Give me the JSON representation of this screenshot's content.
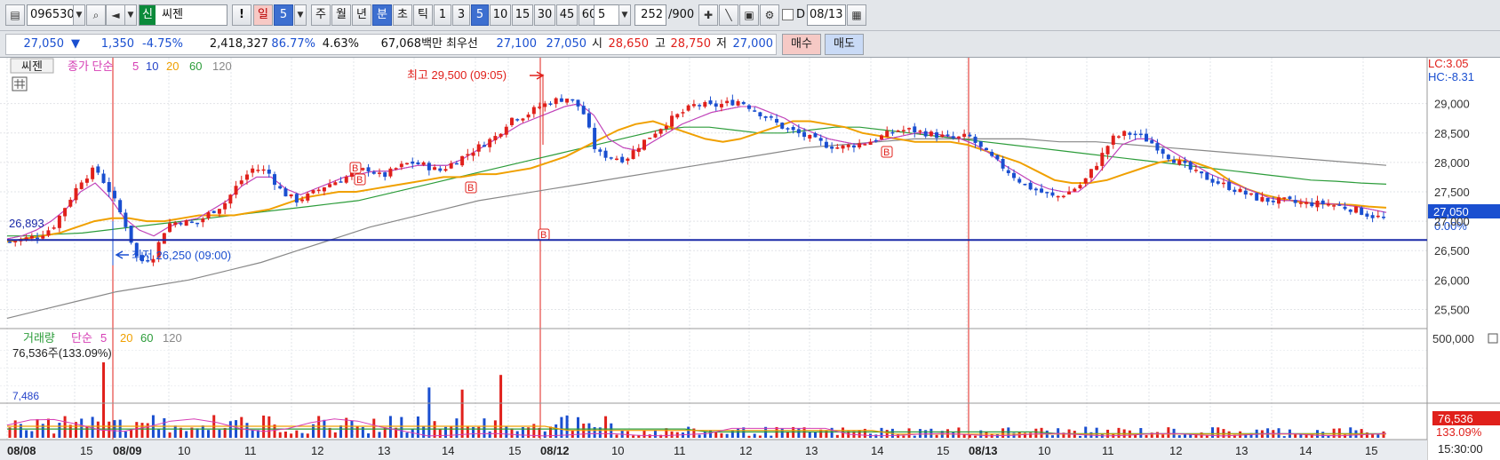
{
  "toolbar": {
    "code": "096530",
    "market_badge": "신",
    "name": "씨젠",
    "alert": "!",
    "period_day": "일",
    "period_day_num": "5",
    "period_week": "주",
    "period_month": "월",
    "period_year": "년",
    "period_min": "분",
    "period_sec": "초",
    "period_tick": "틱",
    "intervals": [
      "1",
      "3",
      "5",
      "10",
      "15",
      "30",
      "45",
      "60"
    ],
    "active_interval": "5",
    "interval_select": "5",
    "count": "252",
    "count_total": "/900",
    "d_label": "D",
    "date": "08/13"
  },
  "quote": {
    "price": "27,050",
    "arrow": "▼",
    "change": "1,350",
    "change_pct": "-4.75%",
    "volume": "2,418,327",
    "ratio": "86.77%",
    "turnover_pct": "4.63%",
    "amount": "67,068백만",
    "best_label": "최우선",
    "best_ask": "27,100",
    "best_bid": "27,050",
    "open_label": "시",
    "open": "28,650",
    "high_label": "고",
    "high": "28,750",
    "low_label": "저",
    "low": "27,000",
    "buy": "매수",
    "sell": "매도"
  },
  "legend": {
    "stock": "씨젠",
    "indicator": "종가 단순",
    "ma": [
      "5",
      "10",
      "20",
      "60",
      "120"
    ],
    "vol_title": "거래량",
    "vol_indicator": "단순",
    "vol_value": "76,536주(133.09%)"
  },
  "annotations": {
    "max": "최고 29,500 (09:05)",
    "min": "최저 26,250 (09:00)",
    "hline_value": "26,893",
    "vol_left": "7,486",
    "buy_marker": "B"
  },
  "right_axis": {
    "lc": "LC:3.05",
    "hc": "HC:-8.31",
    "price_ticks": [
      "29,000",
      "28,500",
      "28,000",
      "27,500",
      "27,000",
      "26,500",
      "26,000",
      "25,500"
    ],
    "current": "27,050",
    "pct": "0.00%",
    "vol_tick": "500,000",
    "vol_current": "76,536",
    "vol_pct": "133.09%",
    "time": "15:30:00"
  },
  "x_axis": [
    "08/08",
    "15",
    "08/09",
    "10",
    "11",
    "12",
    "13",
    "14",
    "15",
    "08/12",
    "10",
    "11",
    "12",
    "13",
    "14",
    "15",
    "08/13",
    "10",
    "11",
    "12",
    "13",
    "14",
    "15"
  ],
  "colors": {
    "up": "#e0201b",
    "down": "#1a4fd0",
    "ma5": "#d63fb5",
    "ma10": "#2443c9",
    "ma20": "#f0a000",
    "ma60": "#2c9c3a",
    "ma120": "#888888",
    "hline": "#1a2aa8"
  },
  "chart_data": {
    "type": "candlestick",
    "y_range": [
      25250,
      29750
    ],
    "vol_range": [
      0,
      500000
    ],
    "hline": 26893,
    "close_path": [
      26650,
      26700,
      26750,
      26900,
      27300,
      27700,
      27900,
      27500,
      27000,
      26300,
      26400,
      26950,
      27000,
      26950,
      27150,
      27300,
      27650,
      27900,
      27850,
      27500,
      27350,
      27450,
      27600,
      27700,
      27800,
      27900,
      27750,
      27900,
      28000,
      27950,
      27850,
      28000,
      28150,
      28300,
      28450,
      28750,
      28800,
      28950,
      29050,
      29100,
      28900,
      28150,
      28100,
      28050,
      28300,
      28500,
      28700,
      28850,
      29000,
      28950,
      29000,
      29050,
      28900,
      28750,
      28600,
      28500,
      28400,
      28300,
      28250,
      28300,
      28350,
      28450,
      28550,
      28550,
      28500,
      28450,
      28400,
      28450,
      28200,
      28000,
      27800,
      27600,
      27500,
      27400,
      27500,
      27650,
      28000,
      28400,
      28500,
      28450,
      28300,
      28100,
      27950,
      27800,
      27700,
      27600,
      27500,
      27400,
      27350,
      27350,
      27300,
      27300,
      27300,
      27250,
      27200,
      27100,
      27050
    ],
    "ma5": [
      26700,
      26750,
      26850,
      27000,
      27200,
      27500,
      27650,
      27400,
      27050,
      26850,
      26750,
      26900,
      27000,
      27050,
      27200,
      27350,
      27600,
      27750,
      27750,
      27550,
      27450,
      27550,
      27650,
      27750,
      27800,
      27850,
      27850,
      27900,
      27950,
      27950,
      27950,
      28050,
      28200,
      28350,
      28500,
      28650,
      28750,
      28850,
      28950,
      29000,
      28800,
      28400,
      28250,
      28200,
      28350,
      28500,
      28650,
      28750,
      28850,
      28900,
      28950,
      28950,
      28850,
      28750,
      28600,
      28500,
      28400,
      28350,
      28300,
      28350,
      28400,
      28450,
      28500,
      28500,
      28450,
      28400,
      28300,
      28150,
      27950,
      27800,
      27650,
      27550,
      27500,
      27500,
      27700,
      28000,
      28300,
      28400,
      28400,
      28250,
      28100,
      27950,
      27800,
      27700,
      27600,
      27500,
      27400,
      27350,
      27350,
      27300,
      27300,
      27280,
      27250,
      27200,
      27150
    ],
    "ma20": [
      26650,
      26700,
      26750,
      26800,
      26900,
      27000,
      27050,
      27050,
      27000,
      27000,
      27050,
      27100,
      27100,
      27100,
      27150,
      27200,
      27300,
      27400,
      27450,
      27500,
      27500,
      27550,
      27600,
      27650,
      27700,
      27750,
      27750,
      27800,
      27800,
      27850,
      27900,
      28000,
      28100,
      28250,
      28400,
      28550,
      28650,
      28700,
      28600,
      28500,
      28400,
      28350,
      28400,
      28500,
      28600,
      28700,
      28700,
      28650,
      28600,
      28500,
      28450,
      28400,
      28350,
      28350,
      28350,
      28300,
      28200,
      28100,
      28000,
      27850,
      27700,
      27650,
      27650,
      27700,
      27800,
      27900,
      28000,
      28050,
      28000,
      27900,
      27700,
      27550,
      27450,
      27380,
      27330,
      27300,
      27290,
      27280,
      27250,
      27230
    ],
    "ma60": [
      26750,
      26750,
      26780,
      26800,
      26850,
      26900,
      26950,
      27000,
      27050,
      27100,
      27150,
      27200,
      27250,
      27300,
      27350,
      27450,
      27550,
      27650,
      27750,
      27850,
      27950,
      28050,
      28150,
      28250,
      28350,
      28450,
      28550,
      28600,
      28600,
      28550,
      28500,
      28500,
      28550,
      28600,
      28600,
      28550,
      28500,
      28450,
      28400,
      28350,
      28300,
      28250,
      28200,
      28150,
      28100,
      28050,
      28000,
      27950,
      27900,
      27850,
      27800,
      27750,
      27700,
      27680,
      27650,
      27630
    ],
    "ma120": [
      25350,
      25500,
      25650,
      25800,
      25900,
      26000,
      26150,
      26300,
      26500,
      26700,
      26900,
      27050,
      27200,
      27350,
      27450,
      27550,
      27650,
      27750,
      27850,
      27950,
      28050,
      28150,
      28250,
      28300,
      28350,
      28400,
      28400,
      28400,
      28400,
      28350,
      28350,
      28300,
      28250,
      28200,
      28150,
      28100,
      28050,
      28000,
      27950
    ],
    "volume_peaks": [
      {
        "x": 118,
        "v": 360000
      },
      {
        "x": 482,
        "v": 240000
      },
      {
        "x": 521,
        "v": 230000
      },
      {
        "x": 565,
        "v": 300000
      }
    ],
    "buy_signals": [
      394,
      399,
      524,
      606,
      992
    ]
  }
}
